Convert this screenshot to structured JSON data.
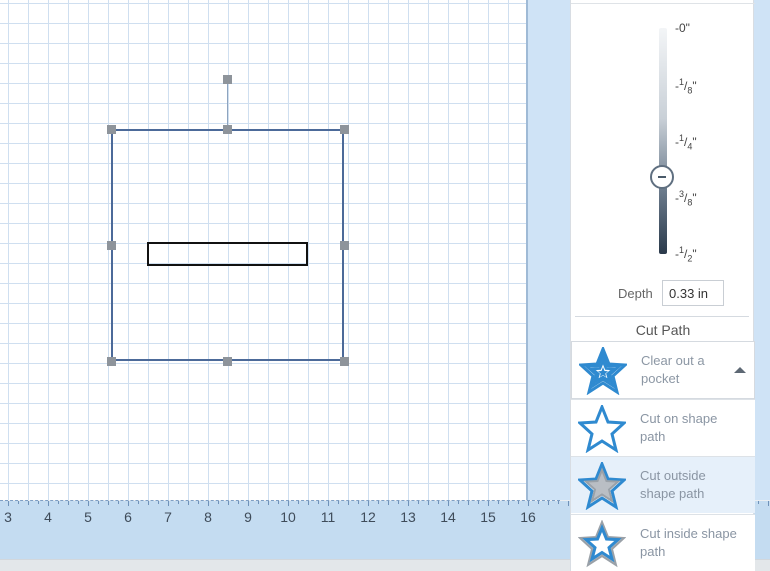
{
  "ruler": {
    "labels": [
      "3",
      "4",
      "5",
      "6",
      "7",
      "8",
      "9",
      "10",
      "11",
      "12",
      "13",
      "14",
      "15",
      "16"
    ]
  },
  "depth": {
    "ticks": {
      "t0": "-0\"",
      "t1_pre": "-",
      "t1_sup": "1",
      "t1_sub": "8",
      "t2_pre": "-",
      "t2_sup": "1",
      "t2_sub": "4",
      "t3_pre": "-",
      "t3_sup": "3",
      "t3_sub": "8",
      "t4_pre": "-",
      "t4_sup": "1",
      "t4_sub": "2",
      "inch": "\""
    },
    "label": "Depth",
    "value": "0.33 in",
    "slider_fraction": 0.66
  },
  "cut_path": {
    "title": "Cut Path",
    "selected": "Clear out a pocket",
    "options": [
      {
        "label": "Cut on shape path",
        "icon": "star-outline-icon"
      },
      {
        "label": "Cut outside shape path",
        "icon": "star-outside-icon"
      },
      {
        "label": "Cut inside shape path",
        "icon": "star-inside-icon"
      }
    ]
  },
  "colors": {
    "grid": "#cfdff0",
    "selection": "#4c6a99",
    "star_blue": "#2f8ad0",
    "highlight": "#e6f0fa"
  }
}
